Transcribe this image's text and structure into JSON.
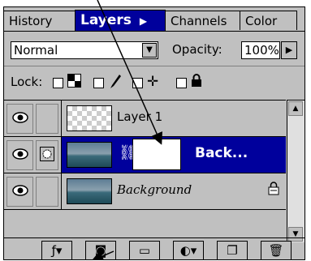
{
  "tabs": [
    {
      "label": "History",
      "active": false
    },
    {
      "label": "Layers",
      "active": true
    },
    {
      "label": "Channels",
      "active": false
    },
    {
      "label": "Color",
      "active": false
    }
  ],
  "blend": {
    "mode": "Normal",
    "opacity_label": "Opacity:",
    "opacity_value": "100%"
  },
  "lock": {
    "label": "Lock:"
  },
  "layers": [
    {
      "name": "Layer 1",
      "visible": true,
      "selected": false
    },
    {
      "name": "Back...",
      "visible": true,
      "selected": true
    },
    {
      "name": "Background",
      "visible": true,
      "selected": false,
      "locked": true
    }
  ],
  "icons": {
    "eye": "eye-icon",
    "chain": "chain-link-icon",
    "lock": "padlock-icon",
    "tabs_arrow": "triangle-right-icon"
  },
  "colors": {
    "selection": "#00009c",
    "panel": "#c0c0c0"
  }
}
